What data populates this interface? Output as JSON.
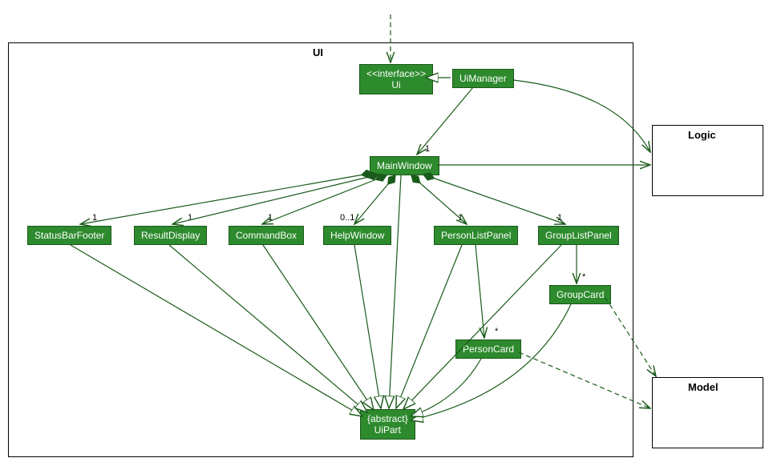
{
  "packages": {
    "ui": {
      "label": "UI"
    },
    "logic": {
      "label": "Logic"
    },
    "model": {
      "label": "Model"
    }
  },
  "classes": {
    "ui_interface": {
      "stereotype": "<<interface>>",
      "name": "Ui"
    },
    "uimanager": {
      "name": "UiManager"
    },
    "mainwindow": {
      "name": "MainWindow"
    },
    "statusbarfooter": {
      "name": "StatusBarFooter"
    },
    "resultdisplay": {
      "name": "ResultDisplay"
    },
    "commandbox": {
      "name": "CommandBox"
    },
    "helpwindow": {
      "name": "HelpWindow"
    },
    "personlistpanel": {
      "name": "PersonListPanel"
    },
    "grouplistpanel": {
      "name": "GroupListPanel"
    },
    "groupcard": {
      "name": "GroupCard"
    },
    "personcard": {
      "name": "PersonCard"
    },
    "uipart": {
      "stereotype": "{abstract}",
      "name": "UiPart"
    }
  },
  "multiplicities": {
    "mainwindow": "1",
    "statusbarfooter": "1",
    "resultdisplay": "1",
    "commandbox": "1",
    "helpwindow": "0..1",
    "personlistpanel": "1",
    "grouplistpanel": "1",
    "groupcard": "*",
    "personcard": "*"
  },
  "chart_data": {
    "type": "uml_class_diagram",
    "packages": [
      {
        "name": "UI",
        "contains": [
          "Ui",
          "UiManager",
          "MainWindow",
          "StatusBarFooter",
          "ResultDisplay",
          "CommandBox",
          "HelpWindow",
          "PersonListPanel",
          "GroupListPanel",
          "GroupCard",
          "PersonCard",
          "UiPart"
        ]
      },
      {
        "name": "Logic",
        "contains": []
      },
      {
        "name": "Model",
        "contains": []
      }
    ],
    "classes": [
      {
        "name": "Ui",
        "stereotype": "interface"
      },
      {
        "name": "UiManager"
      },
      {
        "name": "MainWindow"
      },
      {
        "name": "StatusBarFooter"
      },
      {
        "name": "ResultDisplay"
      },
      {
        "name": "CommandBox"
      },
      {
        "name": "HelpWindow"
      },
      {
        "name": "PersonListPanel"
      },
      {
        "name": "GroupListPanel"
      },
      {
        "name": "GroupCard"
      },
      {
        "name": "PersonCard"
      },
      {
        "name": "UiPart",
        "stereotype": "abstract"
      }
    ],
    "relationships": [
      {
        "from": "external",
        "to": "Ui",
        "type": "dependency"
      },
      {
        "from": "UiManager",
        "to": "Ui",
        "type": "realization"
      },
      {
        "from": "UiManager",
        "to": "MainWindow",
        "type": "association",
        "multiplicity": "1"
      },
      {
        "from": "UiManager",
        "to": "Logic",
        "type": "association"
      },
      {
        "from": "MainWindow",
        "to": "Logic",
        "type": "association"
      },
      {
        "from": "MainWindow",
        "to": "StatusBarFooter",
        "type": "composition",
        "multiplicity": "1"
      },
      {
        "from": "MainWindow",
        "to": "ResultDisplay",
        "type": "composition",
        "multiplicity": "1"
      },
      {
        "from": "MainWindow",
        "to": "CommandBox",
        "type": "composition",
        "multiplicity": "1"
      },
      {
        "from": "MainWindow",
        "to": "HelpWindow",
        "type": "composition",
        "multiplicity": "0..1"
      },
      {
        "from": "MainWindow",
        "to": "PersonListPanel",
        "type": "composition",
        "multiplicity": "1"
      },
      {
        "from": "MainWindow",
        "to": "GroupListPanel",
        "type": "composition",
        "multiplicity": "1"
      },
      {
        "from": "GroupListPanel",
        "to": "GroupCard",
        "type": "association",
        "multiplicity": "*"
      },
      {
        "from": "PersonListPanel",
        "to": "PersonCard",
        "type": "association",
        "multiplicity": "*"
      },
      {
        "from": "MainWindow",
        "to": "UiPart",
        "type": "generalization"
      },
      {
        "from": "StatusBarFooter",
        "to": "UiPart",
        "type": "generalization"
      },
      {
        "from": "ResultDisplay",
        "to": "UiPart",
        "type": "generalization"
      },
      {
        "from": "CommandBox",
        "to": "UiPart",
        "type": "generalization"
      },
      {
        "from": "HelpWindow",
        "to": "UiPart",
        "type": "generalization"
      },
      {
        "from": "PersonListPanel",
        "to": "UiPart",
        "type": "generalization"
      },
      {
        "from": "GroupListPanel",
        "to": "UiPart",
        "type": "generalization"
      },
      {
        "from": "GroupCard",
        "to": "UiPart",
        "type": "generalization"
      },
      {
        "from": "PersonCard",
        "to": "UiPart",
        "type": "generalization"
      },
      {
        "from": "PersonCard",
        "to": "Model",
        "type": "dependency"
      },
      {
        "from": "GroupCard",
        "to": "Model",
        "type": "dependency"
      }
    ]
  }
}
